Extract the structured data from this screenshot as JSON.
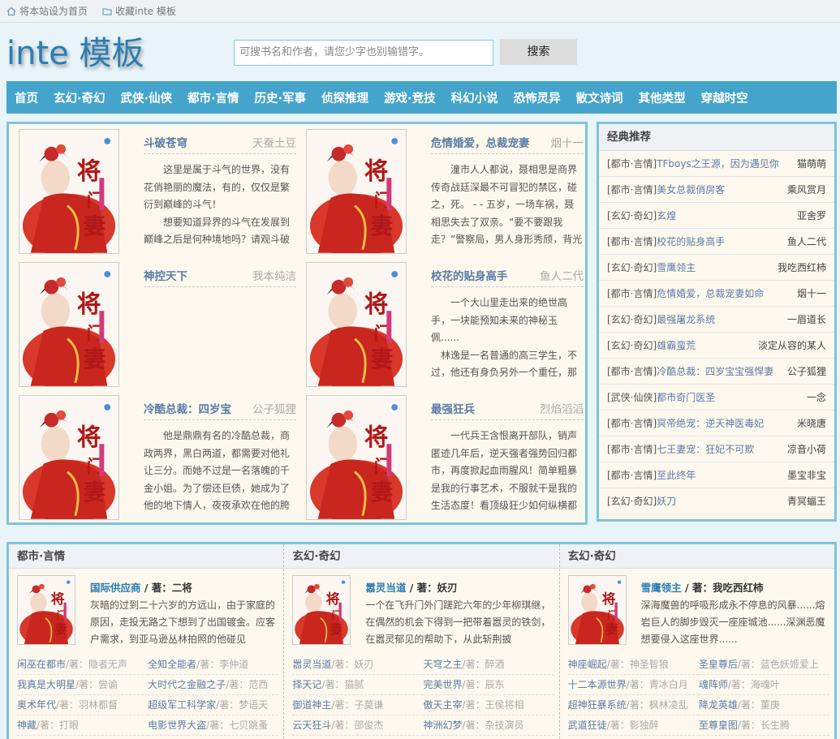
{
  "topbar": {
    "home_label": "将本站设为首页",
    "fav_label": "收藏inte 模板"
  },
  "header": {
    "logo": "inte 模板",
    "search_placeholder": "可搜书名和作者，请您少字也别输错字。",
    "search_button": "搜索"
  },
  "nav": [
    "首页",
    "玄幻·奇幻",
    "武侠·仙侠",
    "都市·言情",
    "历史·军事",
    "侦探推理",
    "游戏·竞技",
    "科幻小说",
    "恐怖灵异",
    "散文诗词",
    "其他类型",
    "穿越时空"
  ],
  "books": [
    {
      "title": "斗破苍穹",
      "author": "天蚕土豆",
      "desc": "　　这里是属于斗气的世界，没有花俏艳丽的魔法，有的，仅仅是繁衍到巅峰的斗气！\n　　想要知道异界的斗气在发展到巅峰之后是何种境地吗？请观斗破苍穹^_^"
    },
    {
      "title": "危情婚爱，总裁宠妻",
      "author": "烟十一",
      "desc": "　　潼市人人都说，聂相思是商界传奇战廷深最不可冒犯的禁区，碰之，死。 - - 五岁，一场车祸，聂相思失去了双亲。“要不要跟我走？”警察局，男人身形秀颀，背光而立，声线玄寒。聂相思没有..."
    },
    {
      "title": "神控天下",
      "author": "我本纯洁",
      "desc": ""
    },
    {
      "title": "校花的贴身高手",
      "author": "鱼人二代",
      "desc": "　　一个大山里走出来的绝世高手，一块能预知未来的神秘玉佩......\n　林逸是一名普通的高三学生，不过，他还有身负另外一个重任，那就是泡校花！而且还是奉校花老..."
    },
    {
      "title": "冷酷总裁：四岁宝",
      "author": "公子狐狸",
      "desc": "　　他是鼎鼎有名的冷酷总裁，商政两界，黑白两道，都需要对他礼让三分。而她不过是一名落魄的千金小姐。为了偿还巨债，她成为了他的地下情人，夜夜承欢在他的胯下。直到玩厌了，厌烦了，彻底..."
    },
    {
      "title": "最强狂兵",
      "author": "烈焰滔滔",
      "desc": "　　一代兵王含恨离开部队，销声匿迹几年后，逆天强者强势回归都市，再度掀起血雨腥风！简单粗暴是我的行事艺术，不服就干是我的生活态度！看顶级狂少如何纵横都市，书写属于他的天王传奇！依..."
    }
  ],
  "sidebar": {
    "heading": "经典推荐",
    "items": [
      {
        "cat": "[都市·言情]",
        "title": "TFboys之王源，因为遇见你",
        "author": "猫萌萌"
      },
      {
        "cat": "[都市·言情]",
        "title": "美女总裁俏房客",
        "author": "乘风赏月"
      },
      {
        "cat": "[玄幻·奇幻]",
        "title": "玄煌",
        "author": "亚舍罗"
      },
      {
        "cat": "[都市·言情]",
        "title": "校花的贴身高手",
        "author": "鱼人二代"
      },
      {
        "cat": "[玄幻·奇幻]",
        "title": "雪鹰领主",
        "author": "我吃西红柿"
      },
      {
        "cat": "[都市·言情]",
        "title": "危情婚爱，总裁宠妻如命",
        "author": "烟十一"
      },
      {
        "cat": "[玄幻·奇幻]",
        "title": "最强屠龙系统",
        "author": "一眉道长"
      },
      {
        "cat": "[玄幻·奇幻]",
        "title": "雄霸蛮荒",
        "author": "淡定从容的某人"
      },
      {
        "cat": "[都市·言情]",
        "title": "冷酷总裁：四岁宝宝强悍妻",
        "author": "公子狐狸"
      },
      {
        "cat": "[武侠·仙侠]",
        "title": "都市奇门医圣",
        "author": "一念"
      },
      {
        "cat": "[都市·言情]",
        "title": "冥帝绝宠：逆天神医毒妃",
        "author": "米晓唐"
      },
      {
        "cat": "[都市·言情]",
        "title": "七王妻宠：狂妃不可欺",
        "author": "凉音小荷"
      },
      {
        "cat": "[都市·言情]",
        "title": "至此终年",
        "author": "墨宝非宝"
      },
      {
        "cat": "[玄幻·奇幻]",
        "title": "妖刀",
        "author": "青冥蝠王"
      }
    ]
  },
  "columns": [
    {
      "heading": "都市·言情",
      "feat_title": "国际供应商",
      "feat_by": " / 著：",
      "feat_author": "二将",
      "feat_desc": "灰暗的过到二十六岁的方远山，由于家庭的原因，走投无路之下想到了出国镀金。应客户需求，到亚马逊丛林拍照的他碰见",
      "list": [
        {
          "t": "闲巫在都市",
          "a": "/著：隐者无声"
        },
        {
          "t": "全知全能者",
          "a": "/著：李仲道"
        },
        {
          "t": "我真是大明星",
          "a": "/著：尝谕"
        },
        {
          "t": "大时代之金融之子",
          "a": "/著：范西"
        },
        {
          "t": "奥术年代",
          "a": "/著：羽林都督"
        },
        {
          "t": "超级军工科学家",
          "a": "/著：梦语天"
        },
        {
          "t": "神藏",
          "a": "/著：打眼"
        },
        {
          "t": "电影世界大盗",
          "a": "/著：七贝跳蚤"
        }
      ]
    },
    {
      "heading": "玄幻·奇幻",
      "feat_title": "嚣灵当道",
      "feat_by": " / 著：",
      "feat_author": "妖刃",
      "feat_desc": "一个在飞升门外门蹉跎六年的少年柳琪继，在偶然的机会下得到一把带着嚣灵的铁剑，在嚣灵郁见的帮助下，从此斩荆披",
      "list": [
        {
          "t": "嚣灵当道",
          "a": "/著：妖刃"
        },
        {
          "t": "天穹之主",
          "a": "/著：醉酒"
        },
        {
          "t": "择天记",
          "a": "/著：猫腻"
        },
        {
          "t": "完美世界",
          "a": "/著：辰东"
        },
        {
          "t": "御道神主",
          "a": "/著：子莫谦"
        },
        {
          "t": "傲天主宰",
          "a": "/著：王侯将相"
        },
        {
          "t": "云天狂斗",
          "a": "/著：邵俊杰"
        },
        {
          "t": "神洲幻梦",
          "a": "/著：杂技演员"
        }
      ]
    },
    {
      "heading": "玄幻·奇幻",
      "feat_title": "雪鹰领主",
      "feat_by": " / 著：",
      "feat_author": "我吃西红柿",
      "feat_desc": "深海魔兽的呼吸形成永不停息的风暴......熔岩巨人的脚步毁灭一座座城池......深渊恶魔想要侵入这座世界......",
      "list": [
        {
          "t": "神座崛起",
          "a": "/著：神圣智狼"
        },
        {
          "t": "圣皇尊后",
          "a": "/著：蓝色妖姬爱上"
        },
        {
          "t": "十二本源世界",
          "a": "/著：青冰白月"
        },
        {
          "t": "魂阵师",
          "a": "/著：海魂叶"
        },
        {
          "t": "超神狂暴系统",
          "a": "/著：枫林凌乱"
        },
        {
          "t": "降龙英雄",
          "a": "/著：菫庚"
        },
        {
          "t": "武道狂徒",
          "a": "/著：影独醉"
        },
        {
          "t": "至尊皇图",
          "a": "/著：长生腾"
        }
      ]
    }
  ]
}
